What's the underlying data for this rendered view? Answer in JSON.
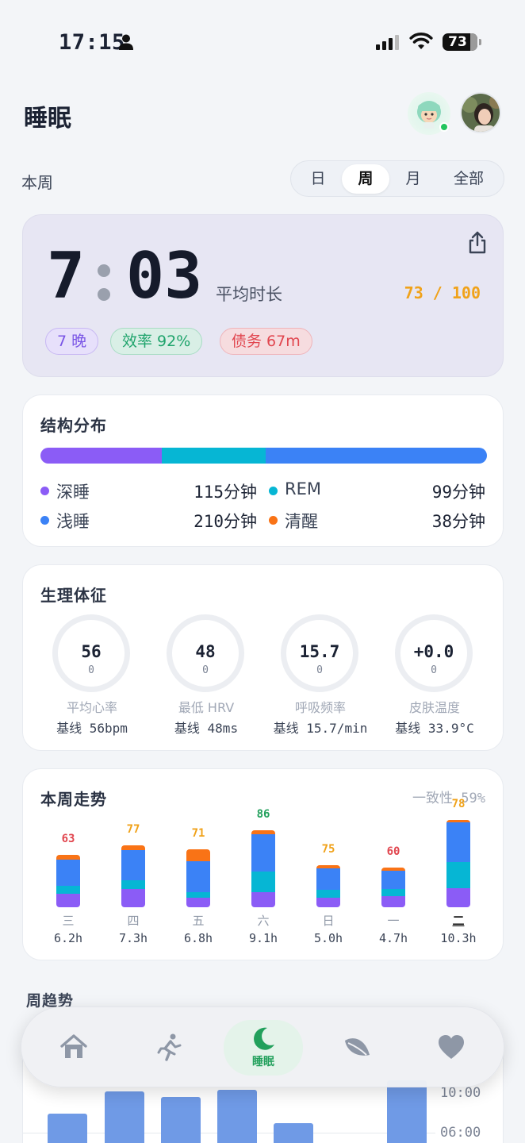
{
  "status_bar": {
    "time": "17:15",
    "battery": "73"
  },
  "header": {
    "title": "睡眠"
  },
  "period": {
    "label": "本周",
    "tabs": [
      {
        "label": "日",
        "active": false
      },
      {
        "label": "周",
        "active": true
      },
      {
        "label": "月",
        "active": false
      },
      {
        "label": "全部",
        "active": false
      }
    ]
  },
  "summary": {
    "hours": "7",
    "minutes": "03",
    "duration_label": "平均时长",
    "score": "73 / 100",
    "pills": {
      "nights": "7 晚",
      "efficiency": "效率 92%",
      "debt": "债务 67m"
    }
  },
  "structure": {
    "title": "结构分布",
    "segments": [
      {
        "name": "深睡",
        "value": "115分钟",
        "minutes": 115,
        "color": "#8b5cf6"
      },
      {
        "name": "REM",
        "value": "99分钟",
        "minutes": 99,
        "color": "#06b6d4"
      },
      {
        "name": "浅睡",
        "value": "210分钟",
        "minutes": 210,
        "color": "#3b82f6"
      },
      {
        "name": "清醒",
        "value": "38分钟",
        "minutes": 38,
        "color": "#f97316"
      }
    ]
  },
  "vitals": {
    "title": "生理体征",
    "items": [
      {
        "value": "56",
        "sub": "0",
        "name": "平均心率",
        "baseline": "基线 56bpm"
      },
      {
        "value": "48",
        "sub": "0",
        "name": "最低 HRV",
        "baseline": "基线 48ms"
      },
      {
        "value": "15.7",
        "sub": "0",
        "name": "呼吸频率",
        "baseline": "基线 15.7/min"
      },
      {
        "value": "+0.0",
        "sub": "0",
        "name": "皮肤温度",
        "baseline": "基线 33.9°C"
      }
    ]
  },
  "week_trend": {
    "title": "本周走势",
    "consistency": "一致性  59%",
    "days": [
      {
        "score": "63",
        "score_color": "#e1464f",
        "day": "三",
        "hours": "6.2h",
        "h": 6.2,
        "deep": 0.26,
        "rem": 0.14,
        "light": 0.5,
        "awake": 0.1
      },
      {
        "score": "77",
        "score_color": "#f0a21a",
        "day": "四",
        "hours": "7.3h",
        "h": 7.3,
        "deep": 0.3,
        "rem": 0.14,
        "light": 0.48,
        "awake": 0.08
      },
      {
        "score": "71",
        "score_color": "#f0a21a",
        "day": "五",
        "hours": "6.8h",
        "h": 6.8,
        "deep": 0.16,
        "rem": 0.1,
        "light": 0.54,
        "awake": 0.2
      },
      {
        "score": "86",
        "score_color": "#22a05c",
        "day": "六",
        "hours": "9.1h",
        "h": 9.1,
        "deep": 0.2,
        "rem": 0.26,
        "light": 0.49,
        "awake": 0.05
      },
      {
        "score": "75",
        "score_color": "#f0a21a",
        "day": "日",
        "hours": "5.0h",
        "h": 5.0,
        "deep": 0.22,
        "rem": 0.2,
        "light": 0.5,
        "awake": 0.08
      },
      {
        "score": "60",
        "score_color": "#e1464f",
        "day": "一",
        "hours": "4.7h",
        "h": 4.7,
        "deep": 0.28,
        "rem": 0.17,
        "light": 0.47,
        "awake": 0.08
      },
      {
        "score": "78",
        "score_color": "#f0a21a",
        "day": "二",
        "hours": "10.3h",
        "h": 10.3,
        "deep": 0.22,
        "rem": 0.3,
        "light": 0.45,
        "awake": 0.03,
        "today": true
      }
    ]
  },
  "weekly": {
    "title": "周趋势",
    "ticks": [
      "10:00",
      "06:00"
    ]
  },
  "tabbar": {
    "tabs": [
      {
        "icon": "home-icon"
      },
      {
        "icon": "run-icon"
      },
      {
        "icon": "moon-icon",
        "label": "睡眠",
        "active": true
      },
      {
        "icon": "leaf-icon"
      },
      {
        "icon": "heart-icon"
      }
    ]
  }
}
